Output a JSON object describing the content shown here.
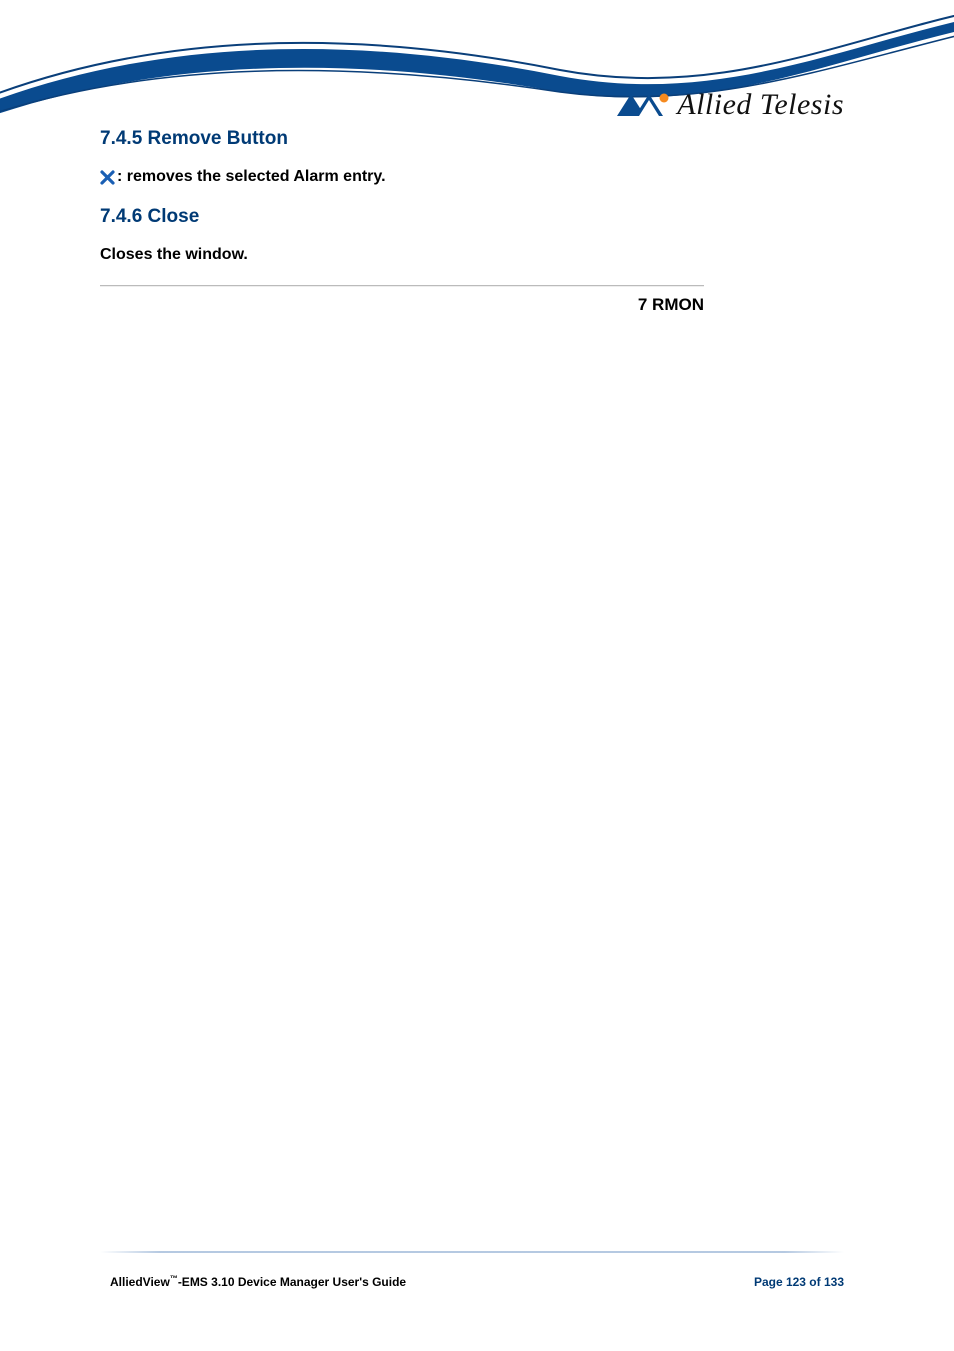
{
  "brand": {
    "name": "Allied Telesis"
  },
  "sections": {
    "s745": {
      "heading": "7.4.5 Remove Button",
      "body": ": removes the selected Alarm entry."
    },
    "s746": {
      "heading": "7.4.6 Close",
      "body": "Closes the window."
    }
  },
  "chapter_label": "7 RMON",
  "footer": {
    "product_prefix": "AlliedView",
    "tm": "™",
    "product_suffix": "-EMS 3.10 Device Manager User's Guide",
    "page": "Page 123 of 133"
  }
}
